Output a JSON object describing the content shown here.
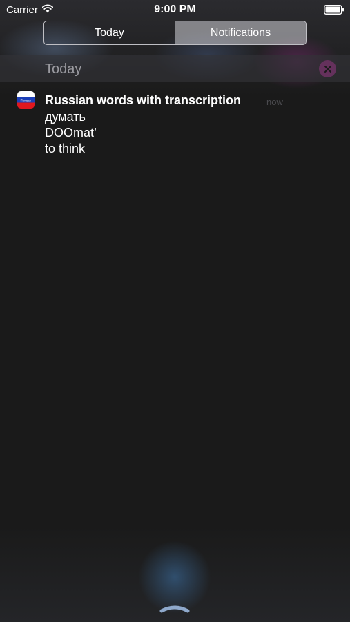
{
  "status_bar": {
    "carrier": "Carrier",
    "time": "9:00 PM",
    "icons": [
      "wifi-icon",
      "battery-icon"
    ]
  },
  "segmented_control": {
    "today_label": "Today",
    "notifications_label": "Notifications",
    "selected": "Notifications"
  },
  "section": {
    "title": "Today",
    "clear_icon": "close-icon",
    "clear_color": "#6e3264"
  },
  "notification": {
    "app_icon": "russian-flag-icon",
    "app_icon_label": "Привет",
    "title": "Russian words with transcription",
    "time": "now",
    "word": "думать",
    "transcription": "DOOmat’",
    "translation": "to think"
  },
  "colors": {
    "background": "#1a1a1a",
    "accent_glow": "#3c6ea0"
  }
}
